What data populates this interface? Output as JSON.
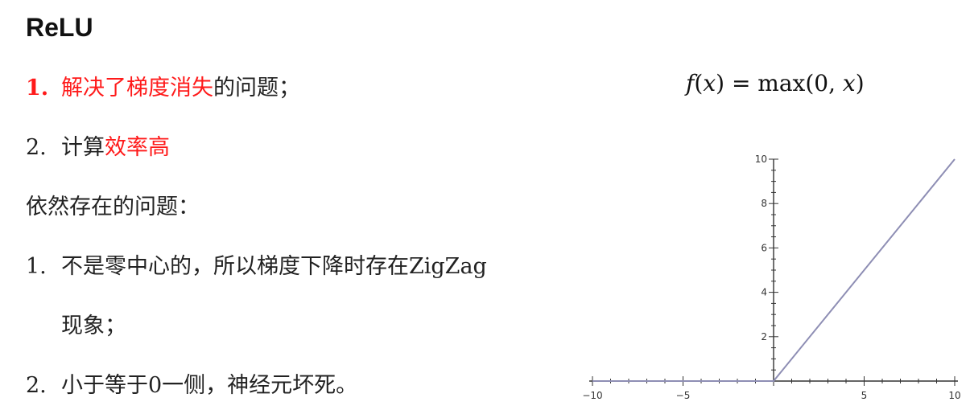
{
  "slide": {
    "title": "ReLU",
    "advantages": [
      {
        "num": "1.",
        "highlight": "解决了梯度消失",
        "rest": "的问题；"
      },
      {
        "num": "2.",
        "prefix": "计算",
        "highlight": "效率高"
      }
    ],
    "issues_heading": "依然存在的问题：",
    "issues": [
      {
        "num": "1.",
        "line1": "不是零中心的，所以梯度下降时存在ZigZag",
        "line2": "现象；"
      },
      {
        "num": "2.",
        "line1": "小于等于0一侧，神经元坏死。"
      }
    ],
    "formula": {
      "f": "f",
      "open": "(",
      "x": "x",
      "close": ")",
      "eq": " = max(0, ",
      "x2": "x",
      "end": ")"
    }
  },
  "chart_data": {
    "type": "line",
    "x": [
      -10,
      0,
      10
    ],
    "y": [
      0,
      0,
      10
    ],
    "xlim": [
      -10,
      10
    ],
    "ylim": [
      0,
      10
    ],
    "xticks": [
      -10,
      -5,
      5,
      10
    ],
    "xtick_labels": [
      "−10",
      "−5",
      "5",
      "10"
    ],
    "yticks": [
      2,
      4,
      6,
      8,
      10
    ],
    "ytick_labels": [
      "2",
      "4",
      "6",
      "8",
      "10"
    ],
    "grid": false,
    "line_color": "#8e8eb4"
  },
  "colors": {
    "highlight": "#ff1a1a",
    "text": "#222222"
  }
}
